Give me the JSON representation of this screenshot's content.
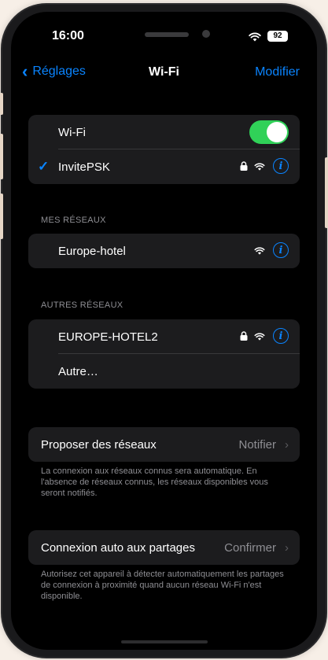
{
  "status_bar": {
    "time": "16:00",
    "battery": "92"
  },
  "nav": {
    "back_label": "Réglages",
    "title": "Wi-Fi",
    "edit_label": "Modifier"
  },
  "wifi_group": {
    "toggle_label": "Wi-Fi",
    "toggle_on": true,
    "connected_network": "InvitePSK"
  },
  "my_networks": {
    "header": "MES RÉSEAUX",
    "items": [
      {
        "name": "Europe-hotel"
      }
    ]
  },
  "other_networks": {
    "header": "AUTRES RÉSEAUX",
    "items": [
      {
        "name": "EUROPE-HOTEL2"
      },
      {
        "name": "Autre…"
      }
    ]
  },
  "ask_to_join": {
    "label": "Proposer des réseaux",
    "value": "Notifier",
    "footnote": "La connexion aux réseaux connus sera automatique. En l'absence de réseaux connus, les réseaux disponibles vous seront notifiés."
  },
  "auto_hotspot": {
    "label": "Connexion auto aux partages",
    "value": "Confirmer",
    "footnote": "Autorisez cet appareil à détecter automatiquement les partages de connexion à proximité quand aucun réseau Wi-Fi n'est disponible."
  },
  "colors": {
    "accent": "#0a84ff",
    "toggle_on": "#30d158",
    "background": "#000000",
    "group_background": "#1c1c1e"
  }
}
